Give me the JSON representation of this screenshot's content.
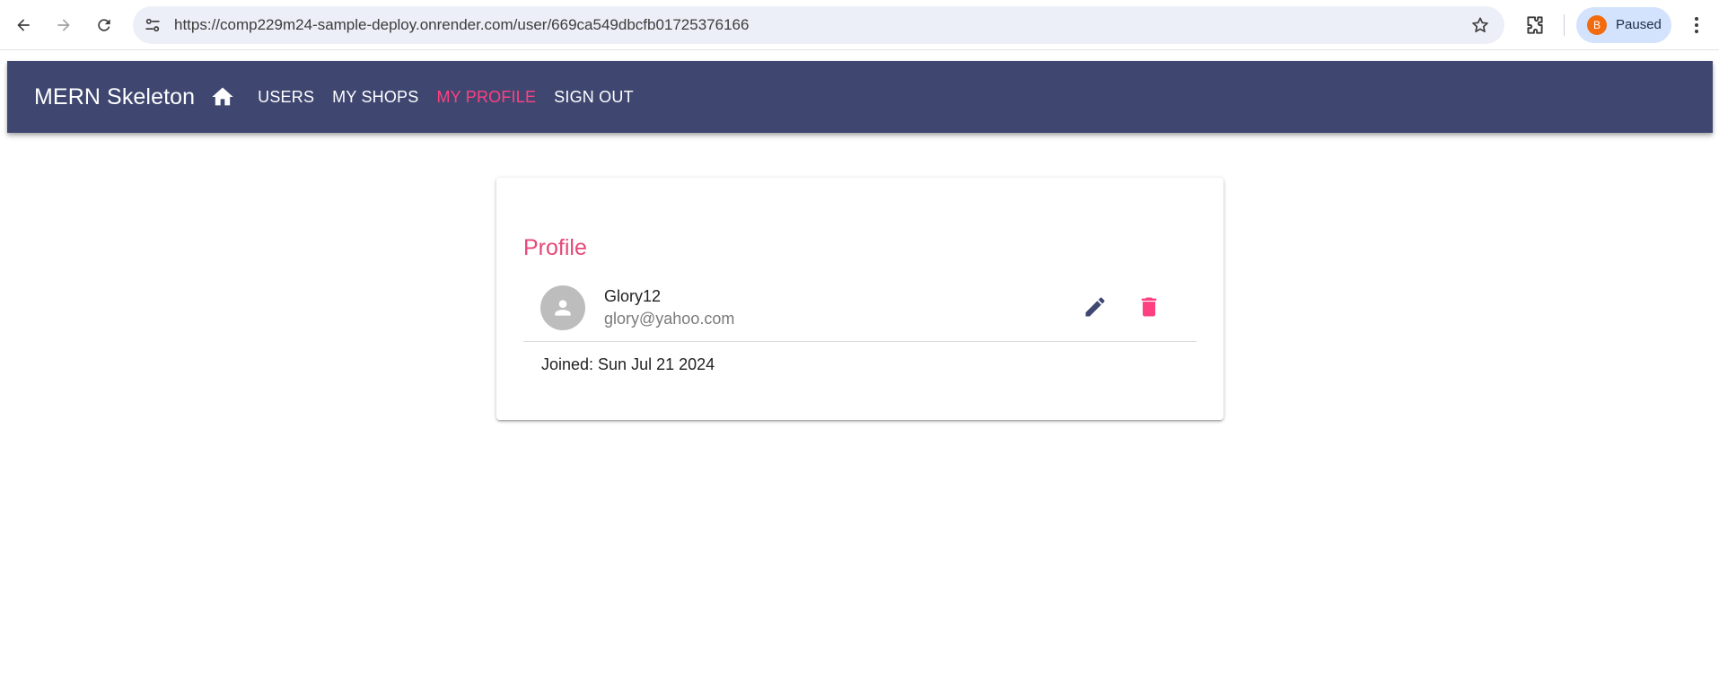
{
  "browser": {
    "url": "https://comp229m24-sample-deploy.onrender.com/user/669ca549dbcfb01725376166",
    "profile_initial": "B",
    "profile_status": "Paused"
  },
  "app_bar": {
    "title": "MERN Skeleton",
    "links": [
      {
        "label": "USERS",
        "active": false
      },
      {
        "label": "MY SHOPS",
        "active": false
      },
      {
        "label": "MY PROFILE",
        "active": true
      },
      {
        "label": "SIGN OUT",
        "active": false
      }
    ]
  },
  "profile": {
    "title": "Profile",
    "name": "Glory12",
    "email": "glory@yahoo.com",
    "joined": "Joined: Sun Jul 21 2024"
  },
  "colors": {
    "app_bar": "#3f4771",
    "accent": "#ff4081",
    "profile_title": "#e74779"
  },
  "icons": {
    "back": "back-arrow-icon",
    "forward": "forward-arrow-icon",
    "reload": "reload-icon",
    "site_info": "tune-icon",
    "bookmark": "star-icon",
    "extensions": "puzzle-icon",
    "menu": "kebab-menu-icon",
    "home": "home-icon",
    "avatar": "person-icon",
    "edit": "pencil-icon",
    "delete": "trash-icon"
  }
}
